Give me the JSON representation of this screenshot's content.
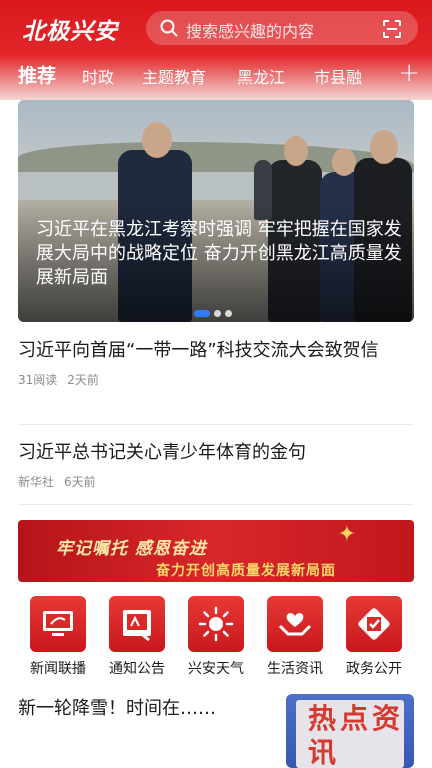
{
  "app": {
    "title": "北极兴安"
  },
  "search": {
    "placeholder": "搜索感兴趣的内容"
  },
  "tabs": [
    {
      "label": "推荐",
      "active": true
    },
    {
      "label": "时政",
      "active": false
    },
    {
      "label": "主题教育",
      "active": false
    },
    {
      "label": "黑龙江",
      "active": false
    },
    {
      "label": "市县融",
      "active": false
    }
  ],
  "tabs_more_icon": "plus-icon",
  "hero": {
    "caption": "习近平在黑龙江考察时强调 牢牢把握在国家发展大局中的战略定位 奋力开创黑龙江高质量发展新局面",
    "slide_count": 3,
    "active_slide": 1
  },
  "news": [
    {
      "title": "习近平向首届“一带一路”科技交流大会致贺信",
      "meta": [
        "31阅读",
        "2天前"
      ]
    },
    {
      "title": "习近平总书记关心青少年体育的金句",
      "meta": [
        "新华社",
        "6天前"
      ]
    }
  ],
  "banner": {
    "line1": "牢记嘱托 感恩奋进",
    "line2": "奋力开创高质量发展新局面"
  },
  "services": [
    {
      "label": "新闻联播",
      "icon": "tv-icon"
    },
    {
      "label": "通知公告",
      "icon": "notice-icon"
    },
    {
      "label": "兴安天气",
      "icon": "sun-icon"
    },
    {
      "label": "生活资讯",
      "icon": "hands-icon"
    },
    {
      "label": "政务公开",
      "icon": "government-icon"
    }
  ],
  "bottom_news": {
    "title": "新一轮降雪！时间在……"
  },
  "hot_card": {
    "text": "热点资讯"
  },
  "colors": {
    "brand_red": "#d9181c",
    "accent_blue": "#2f7bff"
  }
}
